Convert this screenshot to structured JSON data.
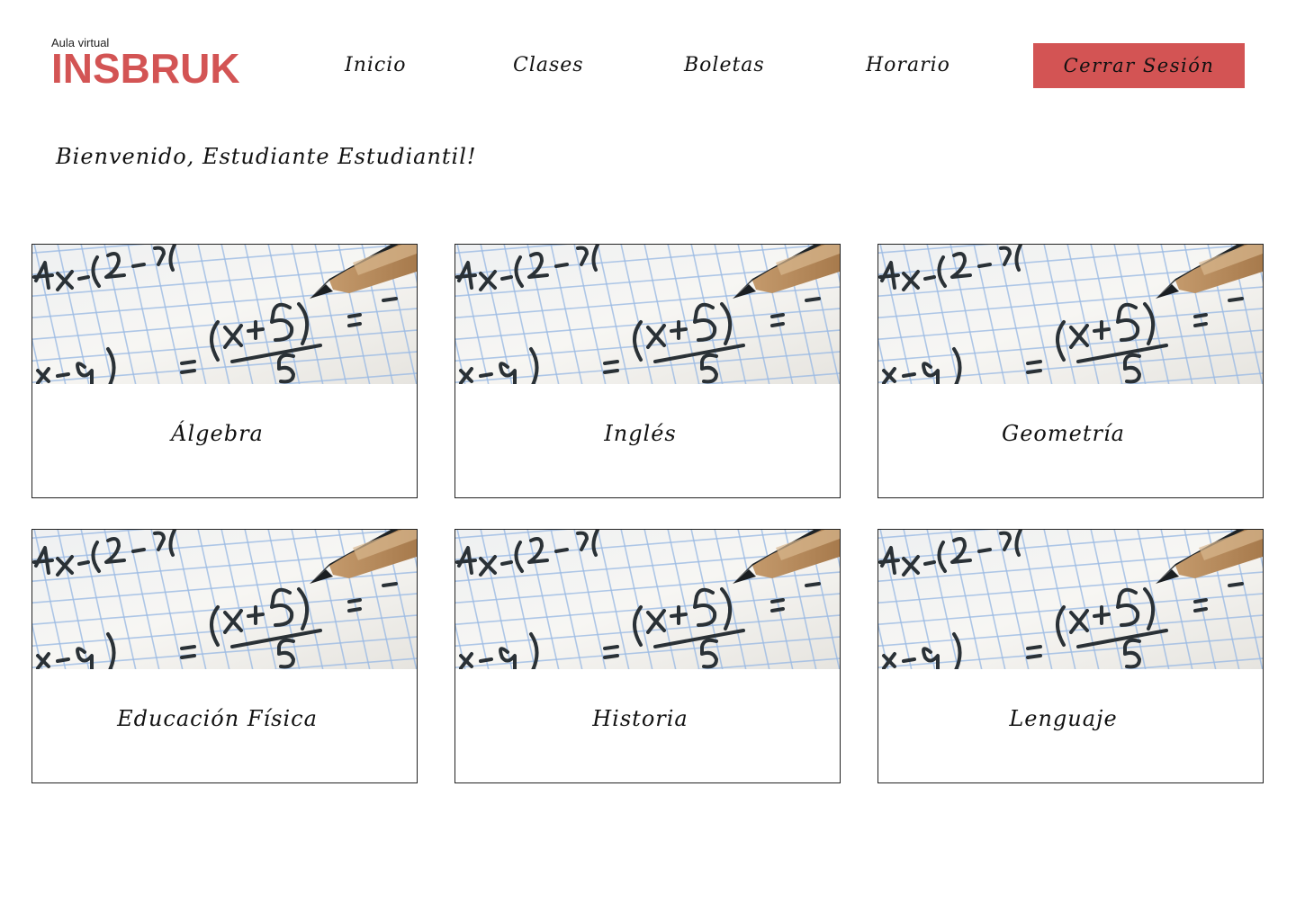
{
  "header": {
    "subtitle": "Aula virtual",
    "brand": "INSBRUK",
    "nav": [
      {
        "label": "Inicio"
      },
      {
        "label": "Clases"
      },
      {
        "label": "Boletas"
      },
      {
        "label": "Horario"
      }
    ],
    "logout_label": "Cerrar Sesión"
  },
  "welcome": "Bienvenido, Estudiante Estudiantil!",
  "classes": [
    {
      "name": "Álgebra",
      "image": "math-equation-pencil"
    },
    {
      "name": "Inglés",
      "image": "math-equation-pencil"
    },
    {
      "name": "Geometría",
      "image": "math-equation-pencil"
    },
    {
      "name": "Educación Física",
      "image": "math-equation-pencil"
    },
    {
      "name": "Historia",
      "image": "math-equation-pencil"
    },
    {
      "name": "Lenguaje",
      "image": "math-equation-pencil"
    }
  ],
  "colors": {
    "brand": "#d35454",
    "logout_bg": "#d35454",
    "grid_line": "#9cbbe4",
    "ink": "#2a3136"
  }
}
